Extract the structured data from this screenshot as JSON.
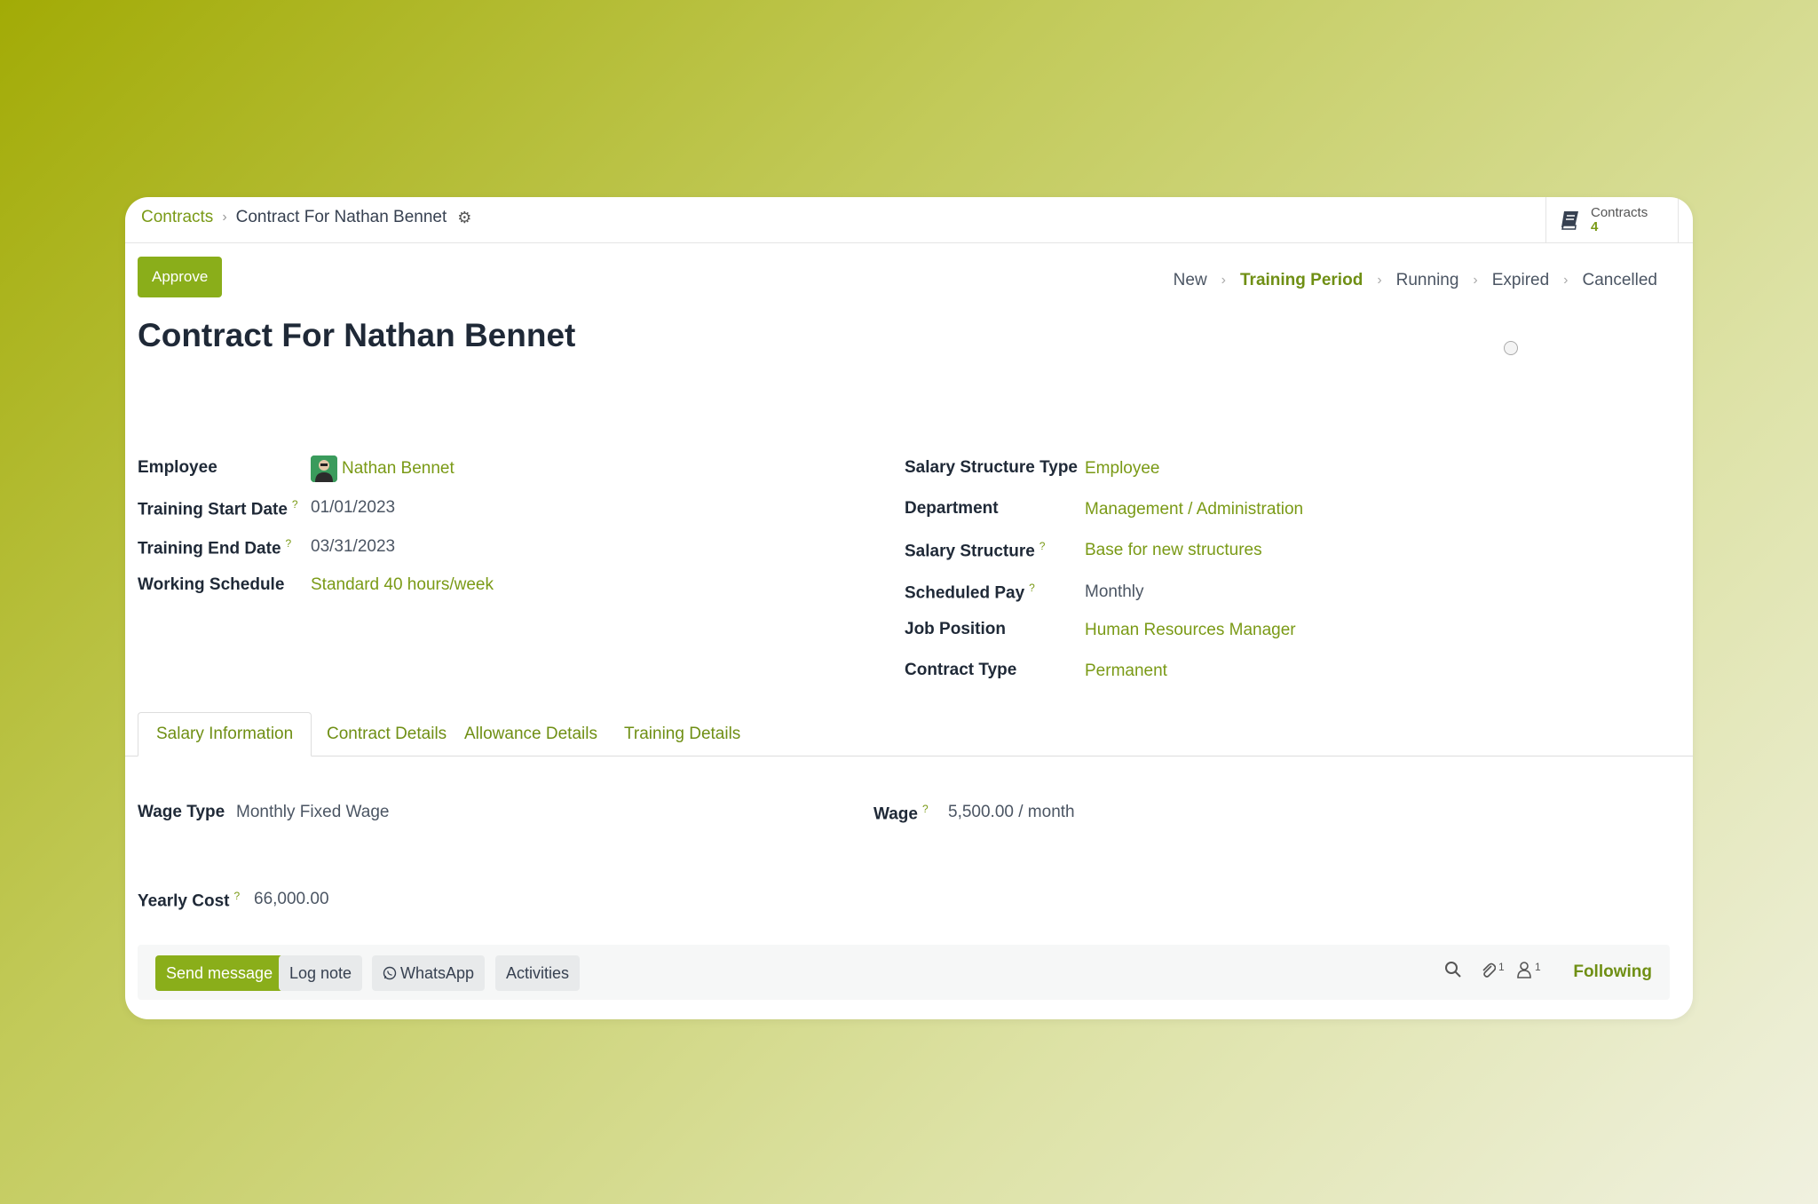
{
  "breadcrumb": {
    "parent": "Contracts",
    "current": "Contract For Nathan Bennet"
  },
  "smart_button": {
    "label": "Contracts",
    "count": "4"
  },
  "actions": {
    "approve": "Approve"
  },
  "status_stages": [
    {
      "label": "New",
      "active": false
    },
    {
      "label": "Training Period",
      "active": true
    },
    {
      "label": "Running",
      "active": false
    },
    {
      "label": "Expired",
      "active": false
    },
    {
      "label": "Cancelled",
      "active": false
    }
  ],
  "title": "Contract For Nathan Bennet",
  "left_fields": {
    "employee": {
      "label": "Employee",
      "value": "Nathan Bennet"
    },
    "training_start": {
      "label": "Training Start Date",
      "help": "?",
      "value": "01/01/2023"
    },
    "training_end": {
      "label": "Training End Date",
      "help": "?",
      "value": "03/31/2023"
    },
    "working_schedule": {
      "label": "Working Schedule",
      "value": "Standard 40 hours/week"
    }
  },
  "right_fields": {
    "salary_structure_type": {
      "label": "Salary Structure Type",
      "value": "Employee"
    },
    "department": {
      "label": "Department",
      "value": "Management / Administration"
    },
    "salary_structure": {
      "label": "Salary Structure",
      "help": "?",
      "value": "Base for new structures"
    },
    "scheduled_pay": {
      "label": "Scheduled Pay",
      "help": "?",
      "value": "Monthly"
    },
    "job_position": {
      "label": "Job Position",
      "value": "Human Resources Manager"
    },
    "contract_type": {
      "label": "Contract Type",
      "value": "Permanent"
    }
  },
  "tabs": [
    {
      "label": "Salary Information",
      "active": true
    },
    {
      "label": "Contract Details",
      "active": false
    },
    {
      "label": "Allowance Details",
      "active": false
    },
    {
      "label": "Training Details",
      "active": false
    }
  ],
  "salary": {
    "wage_type": {
      "label": "Wage Type",
      "value": "Monthly Fixed Wage"
    },
    "wage": {
      "label": "Wage",
      "help": "?",
      "value": "5,500.00",
      "unit": "/ month"
    },
    "yearly_cost": {
      "label": "Yearly Cost",
      "help": "?",
      "value": "66,000.00"
    }
  },
  "chatter": {
    "send_message": "Send message",
    "log_note": "Log note",
    "whatsapp": "WhatsApp",
    "activities": "Activities",
    "attachments_count": "1",
    "followers_count": "1",
    "following": "Following"
  },
  "colors": {
    "accent": "#8aae1a",
    "link": "#7a9a16"
  }
}
